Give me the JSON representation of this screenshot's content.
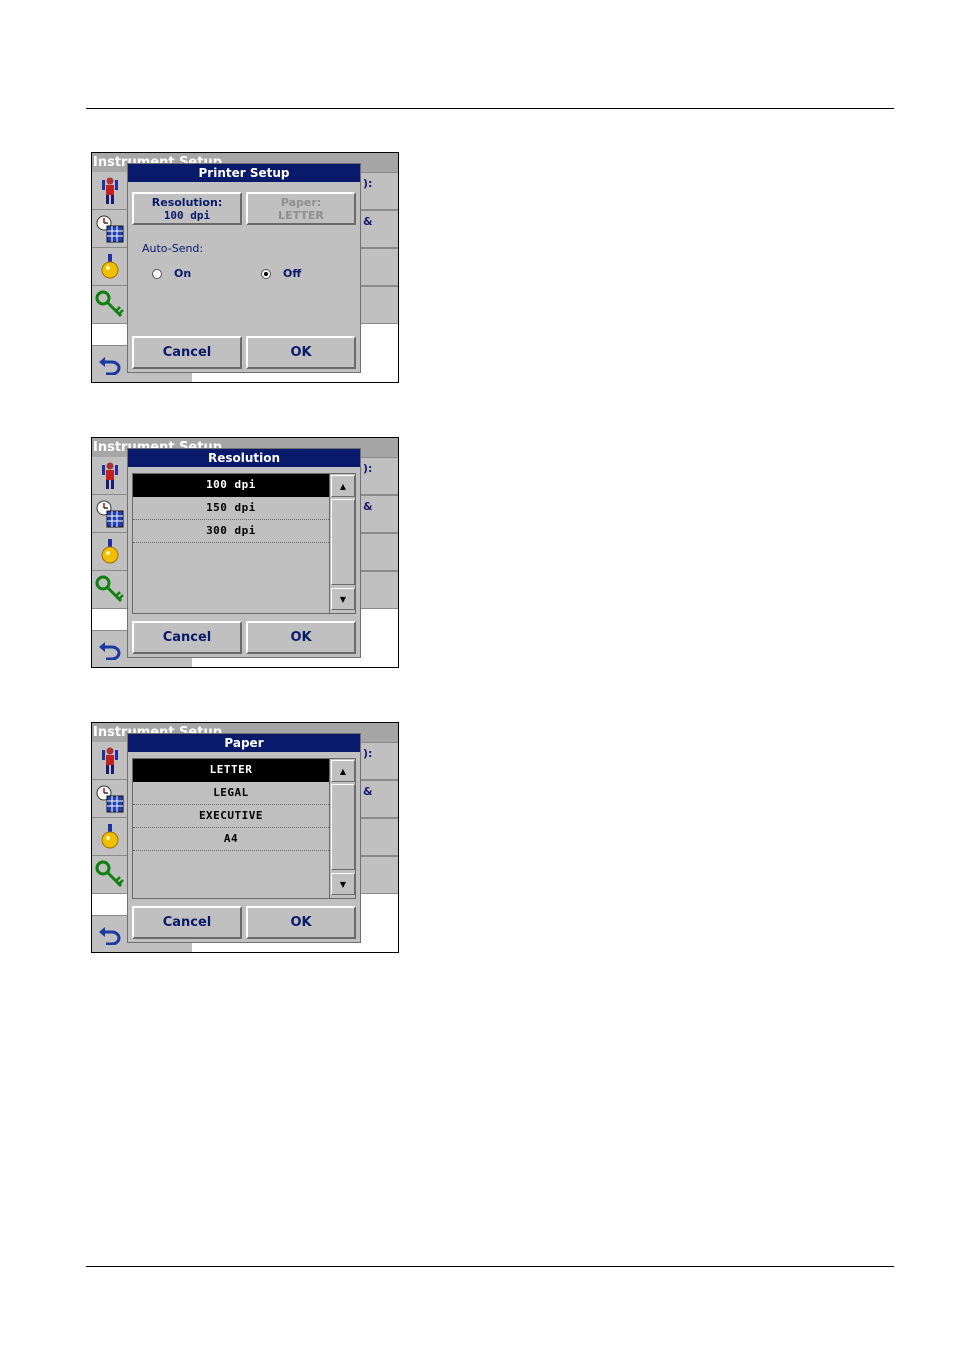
{
  "background_title": "Instrument Setup",
  "right_fragments": [
    "):",
    "&"
  ],
  "screens": [
    {
      "dialog_title": "Printer Setup",
      "resolution_button": {
        "label": "Resolution:",
        "value": "100 dpi"
      },
      "paper_button": {
        "label": "Paper:",
        "value": "LETTER"
      },
      "auto_send": {
        "label": "Auto-Send:",
        "on_label": "On",
        "off_label": "Off",
        "selected": "Off"
      },
      "cancel_label": "Cancel",
      "ok_label": "OK"
    },
    {
      "dialog_title": "Resolution",
      "items": [
        "100 dpi",
        "150 dpi",
        "300 dpi"
      ],
      "selected": "100 dpi",
      "cancel_label": "Cancel",
      "ok_label": "OK"
    },
    {
      "dialog_title": "Paper",
      "items": [
        "LETTER",
        "LEGAL",
        "EXECUTIVE",
        "A4"
      ],
      "selected": "LETTER",
      "cancel_label": "Cancel",
      "ok_label": "OK"
    }
  ],
  "icons": {
    "sidebar": [
      "operator-id-icon",
      "clock-calendar-icon",
      "lamp-icon",
      "key-icon"
    ],
    "back": "back-arrow-icon",
    "scroll_up": "triangle-up-icon",
    "scroll_down": "triangle-down-icon"
  },
  "colors": {
    "dialog_title_bg": "#0a1a6b",
    "panel_gray": "#c0c0c0",
    "selection": "#000000"
  }
}
